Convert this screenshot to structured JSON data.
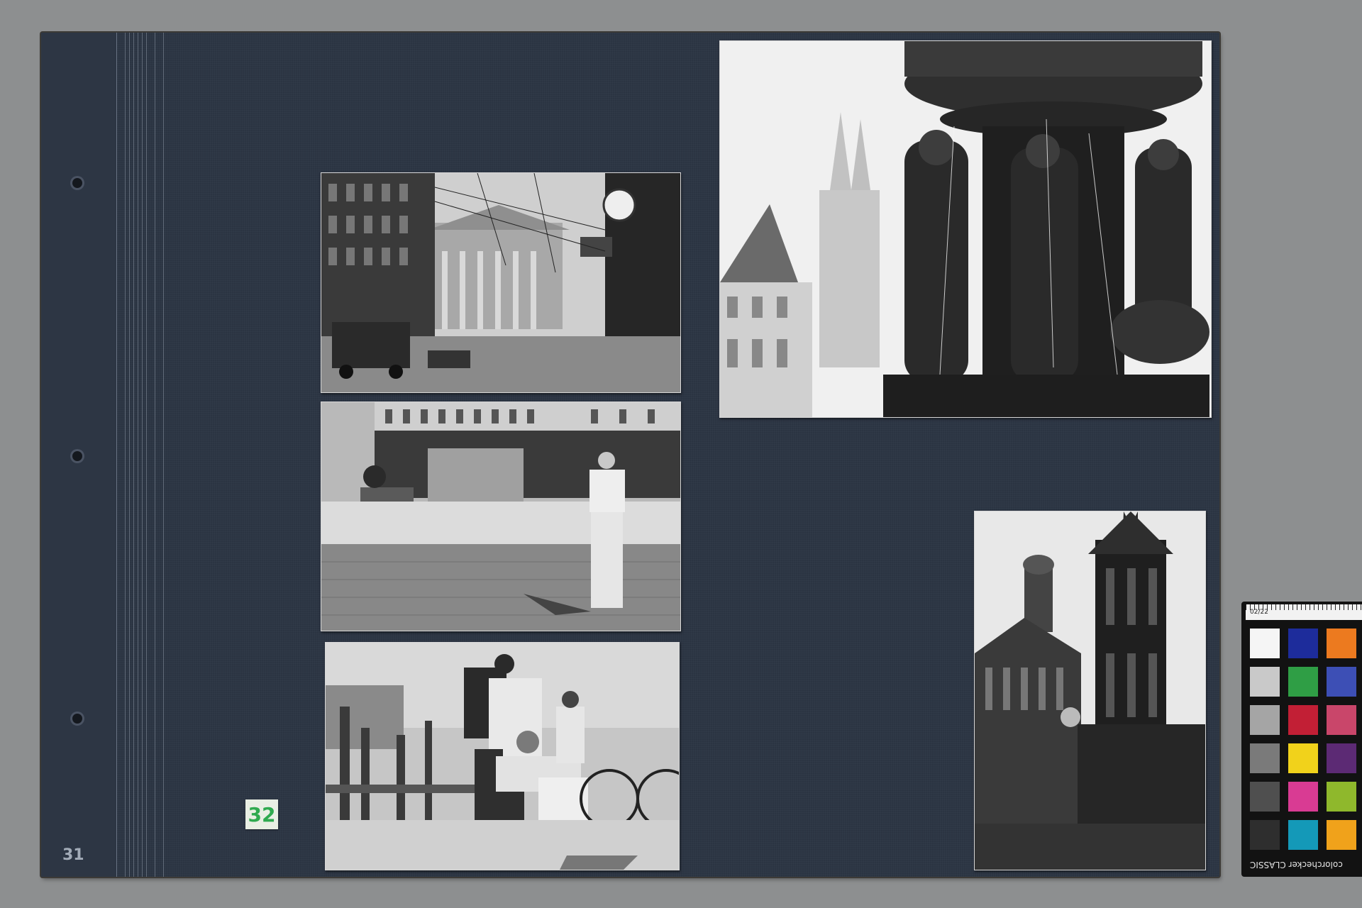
{
  "album_page": {
    "left_page_number": "31",
    "sticker_number": "32"
  },
  "photos": [
    {
      "id": "photo-opera-house-street",
      "subject": "street"
    },
    {
      "id": "photo-plaza-man",
      "subject": "plaza"
    },
    {
      "id": "photo-harbor-children",
      "subject": "children"
    },
    {
      "id": "photo-fountain-church",
      "subject": "fountain"
    },
    {
      "id": "photo-gothic-church",
      "subject": "church"
    }
  ],
  "color_checker": {
    "ruler_label": "02/22",
    "label": "colorchecker CLASSIC",
    "patches": [
      "#f5f5f5",
      "#1d2c9b",
      "#ec7a1f",
      "#c9c9c9",
      "#2f9e45",
      "#3d4fb5",
      "#a5a5a5",
      "#c21f35",
      "#c9466a",
      "#7a7a7a",
      "#f1d21b",
      "#5c2a74",
      "#4f4f4f",
      "#d93b93",
      "#8fb82c",
      "#2e2e2e",
      "#1499b8",
      "#f0a21b"
    ]
  }
}
